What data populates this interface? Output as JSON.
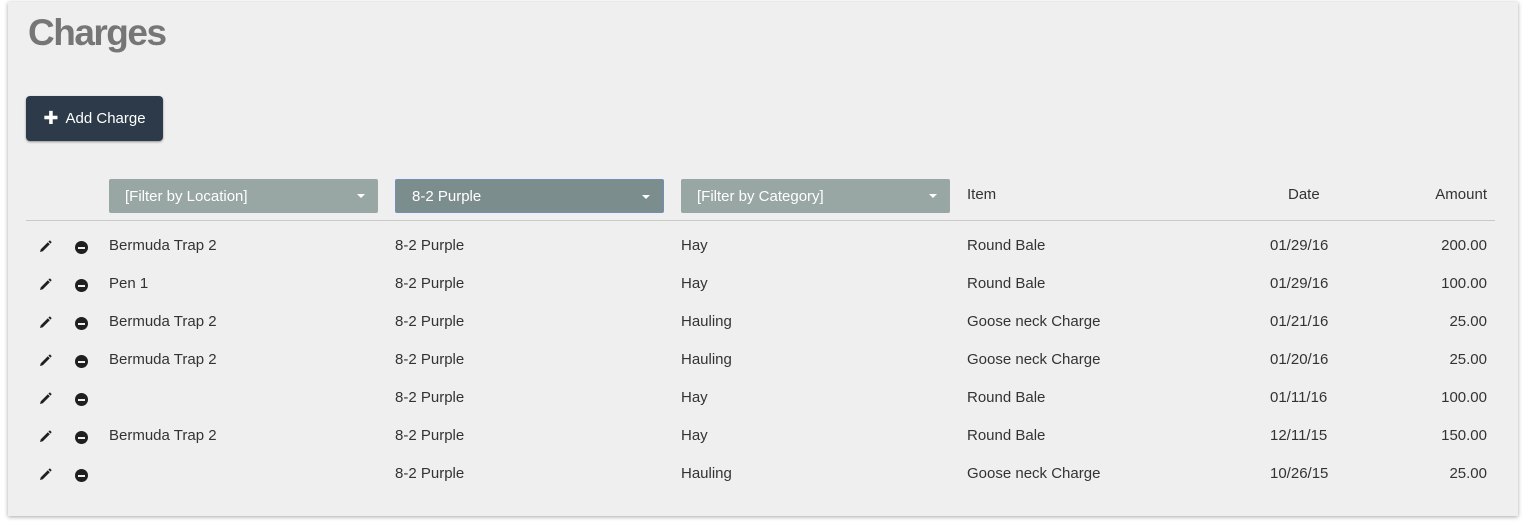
{
  "page": {
    "title": "Charges"
  },
  "toolbar": {
    "add_icon": "plus-icon",
    "add_label": "Add Charge"
  },
  "filters": {
    "location": {
      "label": "[Filter by Location]"
    },
    "lot": {
      "label": "8-2 Purple"
    },
    "category": {
      "label": "[Filter by Category]"
    }
  },
  "columns": {
    "item": "Item",
    "date": "Date",
    "amount": "Amount"
  },
  "row_icons": {
    "edit": "pencil-icon",
    "remove": "minus-circle-icon"
  },
  "rows": [
    {
      "location": "Bermuda Trap 2",
      "lot": "8-2 Purple",
      "category": "Hay",
      "item": "Round Bale",
      "date": "01/29/16",
      "amount": "200.00"
    },
    {
      "location": "Pen 1",
      "lot": "8-2 Purple",
      "category": "Hay",
      "item": "Round Bale",
      "date": "01/29/16",
      "amount": "100.00"
    },
    {
      "location": "Bermuda Trap 2",
      "lot": "8-2 Purple",
      "category": "Hauling",
      "item": "Goose neck Charge",
      "date": "01/21/16",
      "amount": "25.00"
    },
    {
      "location": "Bermuda Trap 2",
      "lot": "8-2 Purple",
      "category": "Hauling",
      "item": "Goose neck Charge",
      "date": "01/20/16",
      "amount": "25.00"
    },
    {
      "location": "",
      "lot": "8-2 Purple",
      "category": "Hay",
      "item": "Round Bale",
      "date": "01/11/16",
      "amount": "100.00"
    },
    {
      "location": "Bermuda Trap 2",
      "lot": "8-2 Purple",
      "category": "Hay",
      "item": "Round Bale",
      "date": "12/11/15",
      "amount": "150.00"
    },
    {
      "location": "",
      "lot": "8-2 Purple",
      "category": "Hauling",
      "item": "Goose neck Charge",
      "date": "10/26/15",
      "amount": "25.00"
    }
  ],
  "colors": {
    "background": "#efefef",
    "button": "#2d3a4a",
    "filter": "#98a6a4",
    "filter_active": "#7c8d8d",
    "title": "#767676"
  }
}
